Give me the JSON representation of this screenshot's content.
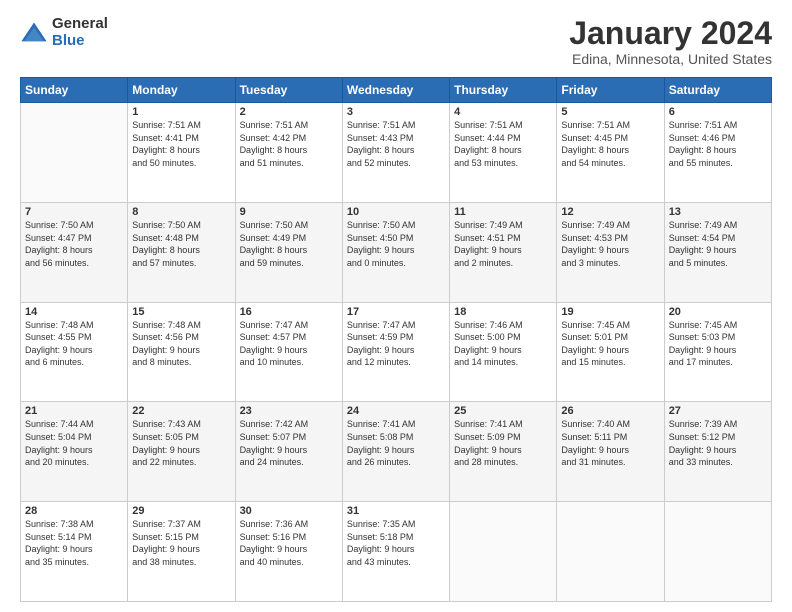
{
  "logo": {
    "general": "General",
    "blue": "Blue"
  },
  "title": "January 2024",
  "location": "Edina, Minnesota, United States",
  "days_of_week": [
    "Sunday",
    "Monday",
    "Tuesday",
    "Wednesday",
    "Thursday",
    "Friday",
    "Saturday"
  ],
  "weeks": [
    [
      {
        "day": "",
        "content": ""
      },
      {
        "day": "1",
        "content": "Sunrise: 7:51 AM\nSunset: 4:41 PM\nDaylight: 8 hours\nand 50 minutes."
      },
      {
        "day": "2",
        "content": "Sunrise: 7:51 AM\nSunset: 4:42 PM\nDaylight: 8 hours\nand 51 minutes."
      },
      {
        "day": "3",
        "content": "Sunrise: 7:51 AM\nSunset: 4:43 PM\nDaylight: 8 hours\nand 52 minutes."
      },
      {
        "day": "4",
        "content": "Sunrise: 7:51 AM\nSunset: 4:44 PM\nDaylight: 8 hours\nand 53 minutes."
      },
      {
        "day": "5",
        "content": "Sunrise: 7:51 AM\nSunset: 4:45 PM\nDaylight: 8 hours\nand 54 minutes."
      },
      {
        "day": "6",
        "content": "Sunrise: 7:51 AM\nSunset: 4:46 PM\nDaylight: 8 hours\nand 55 minutes."
      }
    ],
    [
      {
        "day": "7",
        "content": "Sunrise: 7:50 AM\nSunset: 4:47 PM\nDaylight: 8 hours\nand 56 minutes."
      },
      {
        "day": "8",
        "content": "Sunrise: 7:50 AM\nSunset: 4:48 PM\nDaylight: 8 hours\nand 57 minutes."
      },
      {
        "day": "9",
        "content": "Sunrise: 7:50 AM\nSunset: 4:49 PM\nDaylight: 8 hours\nand 59 minutes."
      },
      {
        "day": "10",
        "content": "Sunrise: 7:50 AM\nSunset: 4:50 PM\nDaylight: 9 hours\nand 0 minutes."
      },
      {
        "day": "11",
        "content": "Sunrise: 7:49 AM\nSunset: 4:51 PM\nDaylight: 9 hours\nand 2 minutes."
      },
      {
        "day": "12",
        "content": "Sunrise: 7:49 AM\nSunset: 4:53 PM\nDaylight: 9 hours\nand 3 minutes."
      },
      {
        "day": "13",
        "content": "Sunrise: 7:49 AM\nSunset: 4:54 PM\nDaylight: 9 hours\nand 5 minutes."
      }
    ],
    [
      {
        "day": "14",
        "content": "Sunrise: 7:48 AM\nSunset: 4:55 PM\nDaylight: 9 hours\nand 6 minutes."
      },
      {
        "day": "15",
        "content": "Sunrise: 7:48 AM\nSunset: 4:56 PM\nDaylight: 9 hours\nand 8 minutes."
      },
      {
        "day": "16",
        "content": "Sunrise: 7:47 AM\nSunset: 4:57 PM\nDaylight: 9 hours\nand 10 minutes."
      },
      {
        "day": "17",
        "content": "Sunrise: 7:47 AM\nSunset: 4:59 PM\nDaylight: 9 hours\nand 12 minutes."
      },
      {
        "day": "18",
        "content": "Sunrise: 7:46 AM\nSunset: 5:00 PM\nDaylight: 9 hours\nand 14 minutes."
      },
      {
        "day": "19",
        "content": "Sunrise: 7:45 AM\nSunset: 5:01 PM\nDaylight: 9 hours\nand 15 minutes."
      },
      {
        "day": "20",
        "content": "Sunrise: 7:45 AM\nSunset: 5:03 PM\nDaylight: 9 hours\nand 17 minutes."
      }
    ],
    [
      {
        "day": "21",
        "content": "Sunrise: 7:44 AM\nSunset: 5:04 PM\nDaylight: 9 hours\nand 20 minutes."
      },
      {
        "day": "22",
        "content": "Sunrise: 7:43 AM\nSunset: 5:05 PM\nDaylight: 9 hours\nand 22 minutes."
      },
      {
        "day": "23",
        "content": "Sunrise: 7:42 AM\nSunset: 5:07 PM\nDaylight: 9 hours\nand 24 minutes."
      },
      {
        "day": "24",
        "content": "Sunrise: 7:41 AM\nSunset: 5:08 PM\nDaylight: 9 hours\nand 26 minutes."
      },
      {
        "day": "25",
        "content": "Sunrise: 7:41 AM\nSunset: 5:09 PM\nDaylight: 9 hours\nand 28 minutes."
      },
      {
        "day": "26",
        "content": "Sunrise: 7:40 AM\nSunset: 5:11 PM\nDaylight: 9 hours\nand 31 minutes."
      },
      {
        "day": "27",
        "content": "Sunrise: 7:39 AM\nSunset: 5:12 PM\nDaylight: 9 hours\nand 33 minutes."
      }
    ],
    [
      {
        "day": "28",
        "content": "Sunrise: 7:38 AM\nSunset: 5:14 PM\nDaylight: 9 hours\nand 35 minutes."
      },
      {
        "day": "29",
        "content": "Sunrise: 7:37 AM\nSunset: 5:15 PM\nDaylight: 9 hours\nand 38 minutes."
      },
      {
        "day": "30",
        "content": "Sunrise: 7:36 AM\nSunset: 5:16 PM\nDaylight: 9 hours\nand 40 minutes."
      },
      {
        "day": "31",
        "content": "Sunrise: 7:35 AM\nSunset: 5:18 PM\nDaylight: 9 hours\nand 43 minutes."
      },
      {
        "day": "",
        "content": ""
      },
      {
        "day": "",
        "content": ""
      },
      {
        "day": "",
        "content": ""
      }
    ]
  ]
}
